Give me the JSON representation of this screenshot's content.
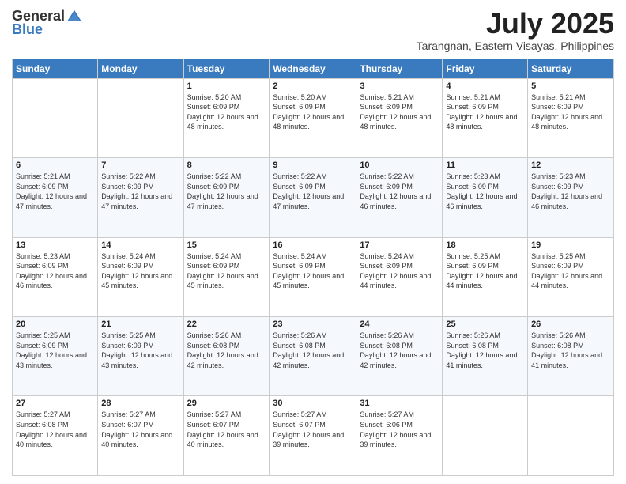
{
  "logo": {
    "general": "General",
    "blue": "Blue"
  },
  "title": {
    "month_year": "July 2025",
    "location": "Tarangnan, Eastern Visayas, Philippines"
  },
  "weekdays": [
    "Sunday",
    "Monday",
    "Tuesday",
    "Wednesday",
    "Thursday",
    "Friday",
    "Saturday"
  ],
  "weeks": [
    [
      {
        "day": "",
        "info": ""
      },
      {
        "day": "",
        "info": ""
      },
      {
        "day": "1",
        "info": "Sunrise: 5:20 AM\nSunset: 6:09 PM\nDaylight: 12 hours and 48 minutes."
      },
      {
        "day": "2",
        "info": "Sunrise: 5:20 AM\nSunset: 6:09 PM\nDaylight: 12 hours and 48 minutes."
      },
      {
        "day": "3",
        "info": "Sunrise: 5:21 AM\nSunset: 6:09 PM\nDaylight: 12 hours and 48 minutes."
      },
      {
        "day": "4",
        "info": "Sunrise: 5:21 AM\nSunset: 6:09 PM\nDaylight: 12 hours and 48 minutes."
      },
      {
        "day": "5",
        "info": "Sunrise: 5:21 AM\nSunset: 6:09 PM\nDaylight: 12 hours and 48 minutes."
      }
    ],
    [
      {
        "day": "6",
        "info": "Sunrise: 5:21 AM\nSunset: 6:09 PM\nDaylight: 12 hours and 47 minutes."
      },
      {
        "day": "7",
        "info": "Sunrise: 5:22 AM\nSunset: 6:09 PM\nDaylight: 12 hours and 47 minutes."
      },
      {
        "day": "8",
        "info": "Sunrise: 5:22 AM\nSunset: 6:09 PM\nDaylight: 12 hours and 47 minutes."
      },
      {
        "day": "9",
        "info": "Sunrise: 5:22 AM\nSunset: 6:09 PM\nDaylight: 12 hours and 47 minutes."
      },
      {
        "day": "10",
        "info": "Sunrise: 5:22 AM\nSunset: 6:09 PM\nDaylight: 12 hours and 46 minutes."
      },
      {
        "day": "11",
        "info": "Sunrise: 5:23 AM\nSunset: 6:09 PM\nDaylight: 12 hours and 46 minutes."
      },
      {
        "day": "12",
        "info": "Sunrise: 5:23 AM\nSunset: 6:09 PM\nDaylight: 12 hours and 46 minutes."
      }
    ],
    [
      {
        "day": "13",
        "info": "Sunrise: 5:23 AM\nSunset: 6:09 PM\nDaylight: 12 hours and 46 minutes."
      },
      {
        "day": "14",
        "info": "Sunrise: 5:24 AM\nSunset: 6:09 PM\nDaylight: 12 hours and 45 minutes."
      },
      {
        "day": "15",
        "info": "Sunrise: 5:24 AM\nSunset: 6:09 PM\nDaylight: 12 hours and 45 minutes."
      },
      {
        "day": "16",
        "info": "Sunrise: 5:24 AM\nSunset: 6:09 PM\nDaylight: 12 hours and 45 minutes."
      },
      {
        "day": "17",
        "info": "Sunrise: 5:24 AM\nSunset: 6:09 PM\nDaylight: 12 hours and 44 minutes."
      },
      {
        "day": "18",
        "info": "Sunrise: 5:25 AM\nSunset: 6:09 PM\nDaylight: 12 hours and 44 minutes."
      },
      {
        "day": "19",
        "info": "Sunrise: 5:25 AM\nSunset: 6:09 PM\nDaylight: 12 hours and 44 minutes."
      }
    ],
    [
      {
        "day": "20",
        "info": "Sunrise: 5:25 AM\nSunset: 6:09 PM\nDaylight: 12 hours and 43 minutes."
      },
      {
        "day": "21",
        "info": "Sunrise: 5:25 AM\nSunset: 6:09 PM\nDaylight: 12 hours and 43 minutes."
      },
      {
        "day": "22",
        "info": "Sunrise: 5:26 AM\nSunset: 6:08 PM\nDaylight: 12 hours and 42 minutes."
      },
      {
        "day": "23",
        "info": "Sunrise: 5:26 AM\nSunset: 6:08 PM\nDaylight: 12 hours and 42 minutes."
      },
      {
        "day": "24",
        "info": "Sunrise: 5:26 AM\nSunset: 6:08 PM\nDaylight: 12 hours and 42 minutes."
      },
      {
        "day": "25",
        "info": "Sunrise: 5:26 AM\nSunset: 6:08 PM\nDaylight: 12 hours and 41 minutes."
      },
      {
        "day": "26",
        "info": "Sunrise: 5:26 AM\nSunset: 6:08 PM\nDaylight: 12 hours and 41 minutes."
      }
    ],
    [
      {
        "day": "27",
        "info": "Sunrise: 5:27 AM\nSunset: 6:08 PM\nDaylight: 12 hours and 40 minutes."
      },
      {
        "day": "28",
        "info": "Sunrise: 5:27 AM\nSunset: 6:07 PM\nDaylight: 12 hours and 40 minutes."
      },
      {
        "day": "29",
        "info": "Sunrise: 5:27 AM\nSunset: 6:07 PM\nDaylight: 12 hours and 40 minutes."
      },
      {
        "day": "30",
        "info": "Sunrise: 5:27 AM\nSunset: 6:07 PM\nDaylight: 12 hours and 39 minutes."
      },
      {
        "day": "31",
        "info": "Sunrise: 5:27 AM\nSunset: 6:06 PM\nDaylight: 12 hours and 39 minutes."
      },
      {
        "day": "",
        "info": ""
      },
      {
        "day": "",
        "info": ""
      }
    ]
  ]
}
